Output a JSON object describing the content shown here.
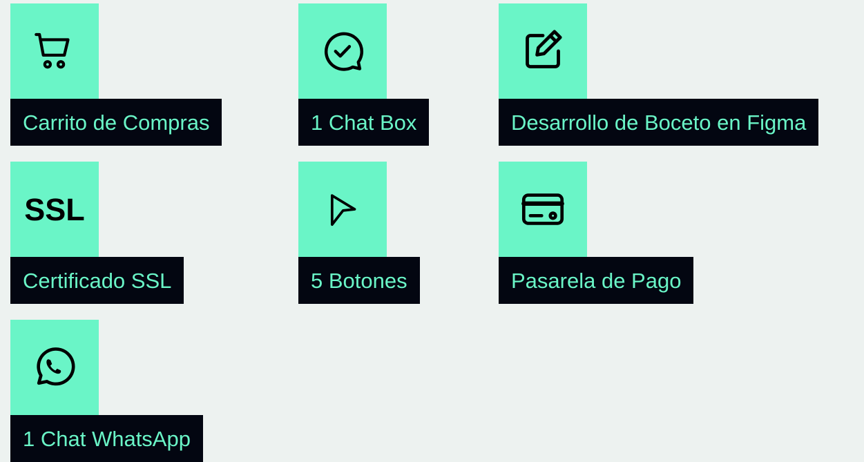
{
  "colors": {
    "background": "#EDF2F0",
    "accent": "#6AF5C7",
    "label_bg": "#030611"
  },
  "features": [
    {
      "label": "Carrito de Compras",
      "icon": "shopping-cart-icon"
    },
    {
      "label": "1 Chat Box",
      "icon": "chat-check-icon"
    },
    {
      "label": "Desarrollo de Boceto en Figma",
      "icon": "edit-icon"
    },
    {
      "label": "Certificado SSL",
      "icon": "ssl-icon",
      "icon_text": "SSL"
    },
    {
      "label": "5 Botones",
      "icon": "cursor-icon"
    },
    {
      "label": "Pasarela de Pago",
      "icon": "credit-card-icon"
    },
    {
      "label": "1 Chat WhatsApp",
      "icon": "whatsapp-icon"
    }
  ]
}
